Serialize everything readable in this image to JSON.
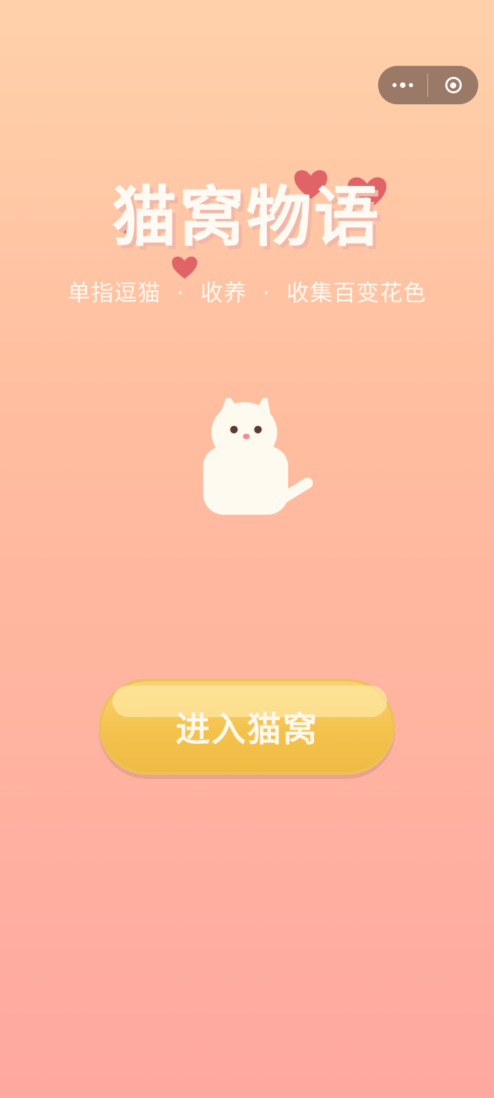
{
  "capsule": {
    "more_icon": "more-dots-icon",
    "close_icon": "target-close-icon"
  },
  "game": {
    "title": "猫窝物语",
    "subtitle": "单指逗猫  ·  收养  ·  收集百变花色"
  },
  "enter_button": {
    "label": "进入猫窝"
  },
  "colors": {
    "background_top": "#ffd1ab",
    "background_bottom": "#ffa8a0",
    "button": "#f4c24c",
    "heart": "#e06467",
    "title": "#fffaf3"
  }
}
